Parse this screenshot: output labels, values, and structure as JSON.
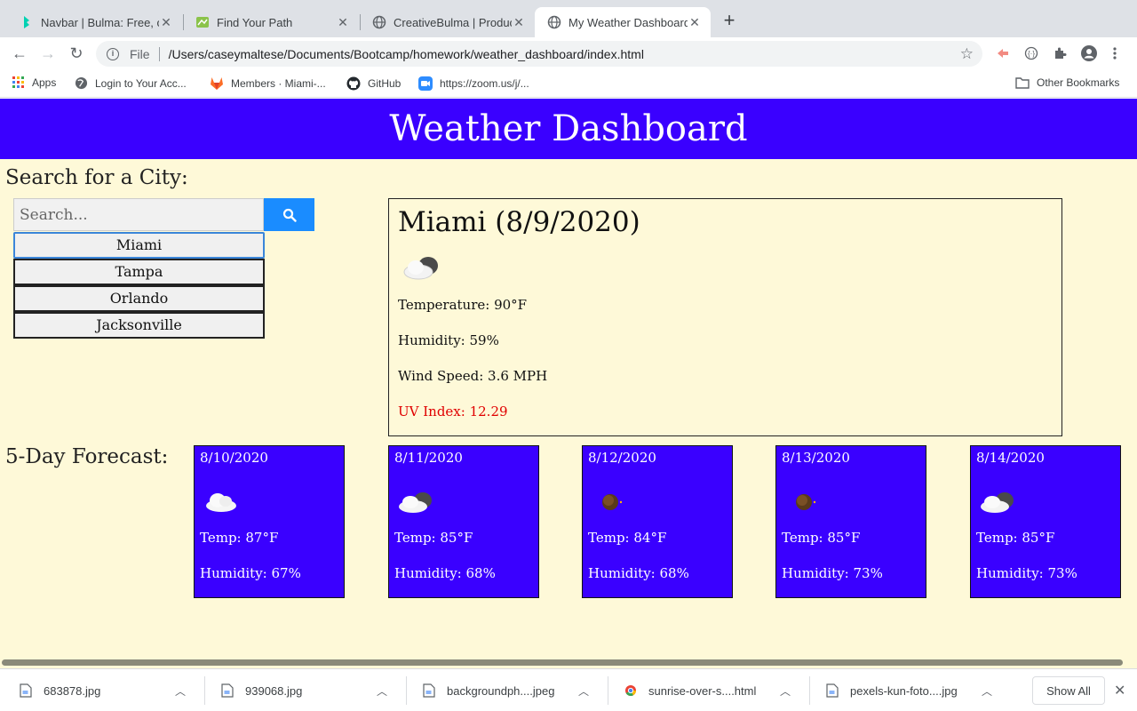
{
  "browser": {
    "tabs": [
      {
        "title": "Navbar | Bulma: Free, o",
        "icon": "bulma-icon",
        "active": false
      },
      {
        "title": "Find Your Path",
        "icon": "map-icon",
        "active": false
      },
      {
        "title": "CreativeBulma | Produc",
        "icon": "globe-icon",
        "active": false
      },
      {
        "title": "My Weather Dashboard",
        "icon": "globe-icon",
        "active": true
      }
    ],
    "new_tab_label": "+",
    "address": {
      "scheme": "File",
      "url": "/Users/caseymaltese/Documents/Bootcamp/homework/weather_dashboard/index.html"
    },
    "bookmarks": [
      {
        "label": "Apps",
        "icon": "apps-grid-icon"
      },
      {
        "label": "Login to Your Acc...",
        "icon": "globe-icon"
      },
      {
        "label": "Members · Miami-...",
        "icon": "gitlab-icon"
      },
      {
        "label": "GitHub",
        "icon": "github-icon"
      },
      {
        "label": "https://zoom.us/j/...",
        "icon": "zoom-icon"
      }
    ],
    "other_bookmarks": "Other Bookmarks"
  },
  "page": {
    "banner_title": "Weather Dashboard",
    "search": {
      "heading": "Search for a City:",
      "placeholder": "Search...",
      "history": [
        "Miami",
        "Tampa",
        "Orlando",
        "Jacksonville"
      ]
    },
    "current": {
      "title": "Miami (8/9/2020)",
      "icon": "partly-cloudy-icon",
      "temperature": "Temperature: 90°F",
      "humidity": "Humidity: 59%",
      "wind": "Wind Speed: 3.6 MPH",
      "uv": "UV Index: 12.29",
      "uv_color": "#e00000"
    },
    "forecast": {
      "heading": "5-Day Forecast:",
      "days": [
        {
          "date": "8/10/2020",
          "icon": "cloud-icon",
          "temp": "Temp: 87°F",
          "humidity": "Humidity: 67%"
        },
        {
          "date": "8/11/2020",
          "icon": "partly-cloudy-icon",
          "temp": "Temp: 85°F",
          "humidity": "Humidity: 68%"
        },
        {
          "date": "8/12/2020",
          "icon": "moon-icon",
          "temp": "Temp: 84°F",
          "humidity": "Humidity: 68%"
        },
        {
          "date": "8/13/2020",
          "icon": "moon-icon",
          "temp": "Temp: 85°F",
          "humidity": "Humidity: 73%"
        },
        {
          "date": "8/14/2020",
          "icon": "partly-cloudy-icon",
          "temp": "Temp: 85°F",
          "humidity": "Humidity: 73%"
        }
      ]
    },
    "colors": {
      "banner": "#3a00ff",
      "background": "#fef9d8",
      "search_button": "#1a8cff"
    }
  },
  "downloads": {
    "files": [
      "683878.jpg",
      "939068.jpg",
      "backgroundph....jpeg",
      "sunrise-over-s....html",
      "pexels-kun-foto....jpg"
    ],
    "show_all": "Show All"
  }
}
